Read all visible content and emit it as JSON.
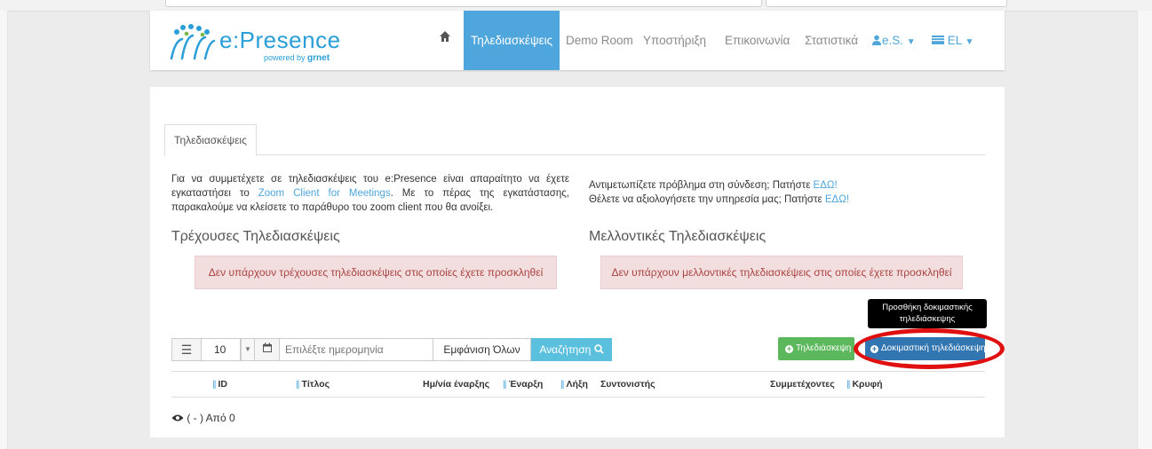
{
  "logo": {
    "name": "e:Presence",
    "powered": "powered by",
    "org": "grnet"
  },
  "nav": {
    "items": [
      {
        "label": "Τηλεδιασκέψεις"
      },
      {
        "label": "Demo Room"
      },
      {
        "label": "Υποστήριξη"
      },
      {
        "label": "Επικοινωνία"
      },
      {
        "label": "Στατιστικά"
      }
    ],
    "user": "e.S.",
    "language": "EL"
  },
  "tab": {
    "label": "Τηλεδιασκέψεις"
  },
  "info": {
    "left_1": "Για να συμμετέχετε σε τηλεδιασκέψεις του e:Presence είναι απαραίτητο να έχετε εγκαταστήσει το ",
    "left_link": "Zoom Client for Meetings",
    "left_2": ". Με το πέρας της εγκατάστασης, παρακαλούμε να κλείσετε το παράθυρο του zoom client που θα ανοίξει.",
    "right_1": "Αντιμετωπίζετε πρόβλημα στη σύνδεση; Πατήστε ",
    "right_link_1": "ΕΔΩ!",
    "right_2": "Θέλετε να αξιολογήσετε την υπηρεσία μας; Πατήστε ",
    "right_link_2": "ΕΔΩ!"
  },
  "current": {
    "title": "Τρέχουσες Τηλεδιασκέψεις",
    "alert": "Δεν υπάρχουν τρέχουσες τηλεδιασκέψεις στις οποίες έχετε προσκληθεί"
  },
  "upcoming": {
    "title": "Μελλοντικές Τηλεδιασκέψεις",
    "alert": "Δεν υπάρχουν μελλοντικές τηλεδιασκέψεις στις οποίες έχετε προσκληθεί"
  },
  "toolbar": {
    "page_size": "10",
    "date_placeholder": "Επιλέξτε ημερομηνία",
    "show_all": "Εμφάνιση Όλων",
    "search": "Αναζήτηση",
    "new_conference": "Τηλεδιάσκεψη",
    "test_conference": "Δοκιμαστική τηλεδιάσκεψη",
    "tooltip": "Προσθήκη δοκιμαστικής τηλεδιάσκεψης"
  },
  "table": {
    "columns": [
      {
        "label": "ID",
        "sortable": true
      },
      {
        "label": "Τίτλος",
        "sortable": true
      },
      {
        "label": "Ημ/νία έναρξης",
        "sortable": false
      },
      {
        "label": "Έναρξη",
        "sortable": true
      },
      {
        "label": "Λήξη",
        "sortable": true
      },
      {
        "label": "Συντονιστής",
        "sortable": false
      },
      {
        "label": "Συμμετέχοντες",
        "sortable": false
      },
      {
        "label": "Κρυφή",
        "sortable": true
      }
    ]
  },
  "footer": {
    "count": "( - ) Από 0"
  },
  "colors": {
    "brand": "#2a9ed8",
    "active_nav": "#4ea6dc",
    "alert_bg": "#f2dede",
    "alert_text": "#a94442",
    "green": "#5cb85c",
    "primary": "#3276b1",
    "highlight": "#e01010"
  }
}
